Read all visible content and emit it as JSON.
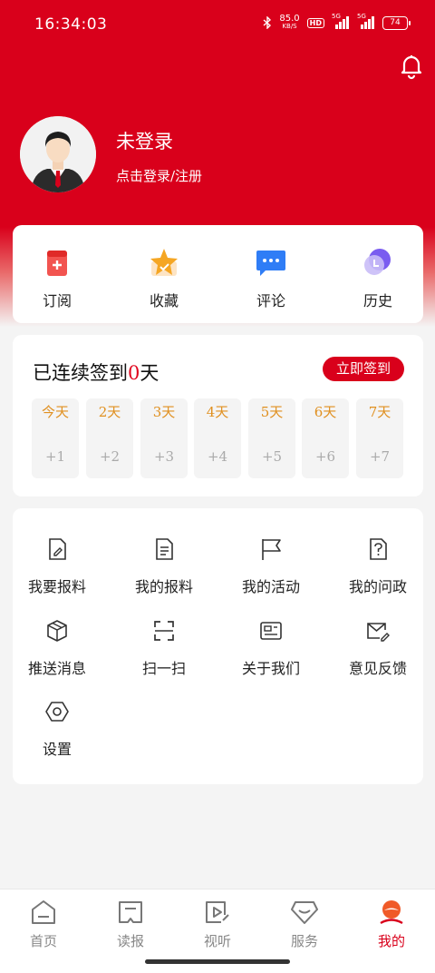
{
  "status_bar": {
    "time": "16:34:03",
    "net_speed_value": "85.0",
    "net_speed_unit": "KB/S",
    "hd_label": "HD",
    "sig1_label": "5G",
    "sig2_label": "5G",
    "battery": "74"
  },
  "header": {
    "title": "未登录",
    "subtitle": "点击登录/注册",
    "accent_color": "#d9001b"
  },
  "quick_actions": [
    {
      "label": "订阅",
      "icon": "subscribe-icon"
    },
    {
      "label": "收藏",
      "icon": "star-icon"
    },
    {
      "label": "评论",
      "icon": "comment-icon"
    },
    {
      "label": "历史",
      "icon": "history-clock-icon"
    }
  ],
  "checkin": {
    "title_prefix": "已连续签到",
    "count": "0",
    "title_suffix": "天",
    "button": "立即签到",
    "days": [
      {
        "label": "今天",
        "points": "+1"
      },
      {
        "label": "2天",
        "points": "+2"
      },
      {
        "label": "3天",
        "points": "+3"
      },
      {
        "label": "4天",
        "points": "+4"
      },
      {
        "label": "5天",
        "points": "+5"
      },
      {
        "label": "6天",
        "points": "+6"
      },
      {
        "label": "7天",
        "points": "+7"
      }
    ]
  },
  "menu": [
    {
      "label": "我要报料",
      "icon": "document-edit-icon"
    },
    {
      "label": "我的报料",
      "icon": "document-list-icon"
    },
    {
      "label": "我的活动",
      "icon": "flag-icon"
    },
    {
      "label": "我的问政",
      "icon": "question-document-icon"
    },
    {
      "label": "推送消息",
      "icon": "cube-icon"
    },
    {
      "label": "扫一扫",
      "icon": "scan-icon"
    },
    {
      "label": "关于我们",
      "icon": "info-card-icon"
    },
    {
      "label": "意见反馈",
      "icon": "mail-edit-icon"
    },
    {
      "label": "设置",
      "icon": "settings-hexagon-icon"
    }
  ],
  "tabbar": [
    {
      "label": "首页",
      "icon": "home-icon",
      "active": false
    },
    {
      "label": "读报",
      "icon": "newspaper-icon",
      "active": false
    },
    {
      "label": "视听",
      "icon": "video-play-icon",
      "active": false
    },
    {
      "label": "服务",
      "icon": "service-diamond-icon",
      "active": false
    },
    {
      "label": "我的",
      "icon": "profile-icon",
      "active": true
    }
  ]
}
